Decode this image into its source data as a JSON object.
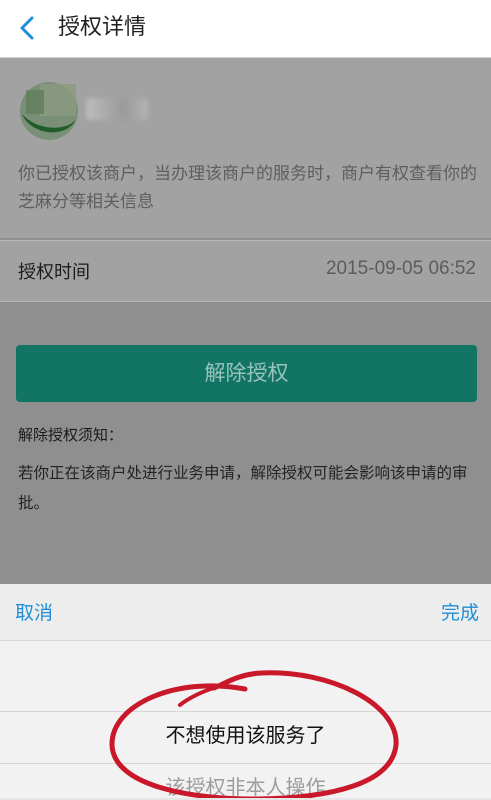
{
  "header": {
    "back_icon": "chevron-left-icon",
    "title": "授权详情"
  },
  "merchant": {
    "logo_icon": "merchant-logo",
    "description": "你已授权该商户，当办理该商户的服务时，商户有权查看你的芝麻分等相关信息"
  },
  "auth_time": {
    "label": "授权时间",
    "value": "2015-09-05 06:52"
  },
  "revoke": {
    "button_label": "解除授权",
    "notice_title": "解除授权须知：",
    "notice_body": "若你正在该商户处进行业务申请，解除授权可能会影响该申请的审批。"
  },
  "picker": {
    "cancel_label": "取消",
    "done_label": "完成",
    "options": [
      "不想使用该服务了",
      "该授权非本人操作"
    ],
    "selected_index": 0
  },
  "colors": {
    "accent_blue": "#1f8ed8",
    "button_green": "#127564",
    "annotation_red": "#c8182a"
  }
}
